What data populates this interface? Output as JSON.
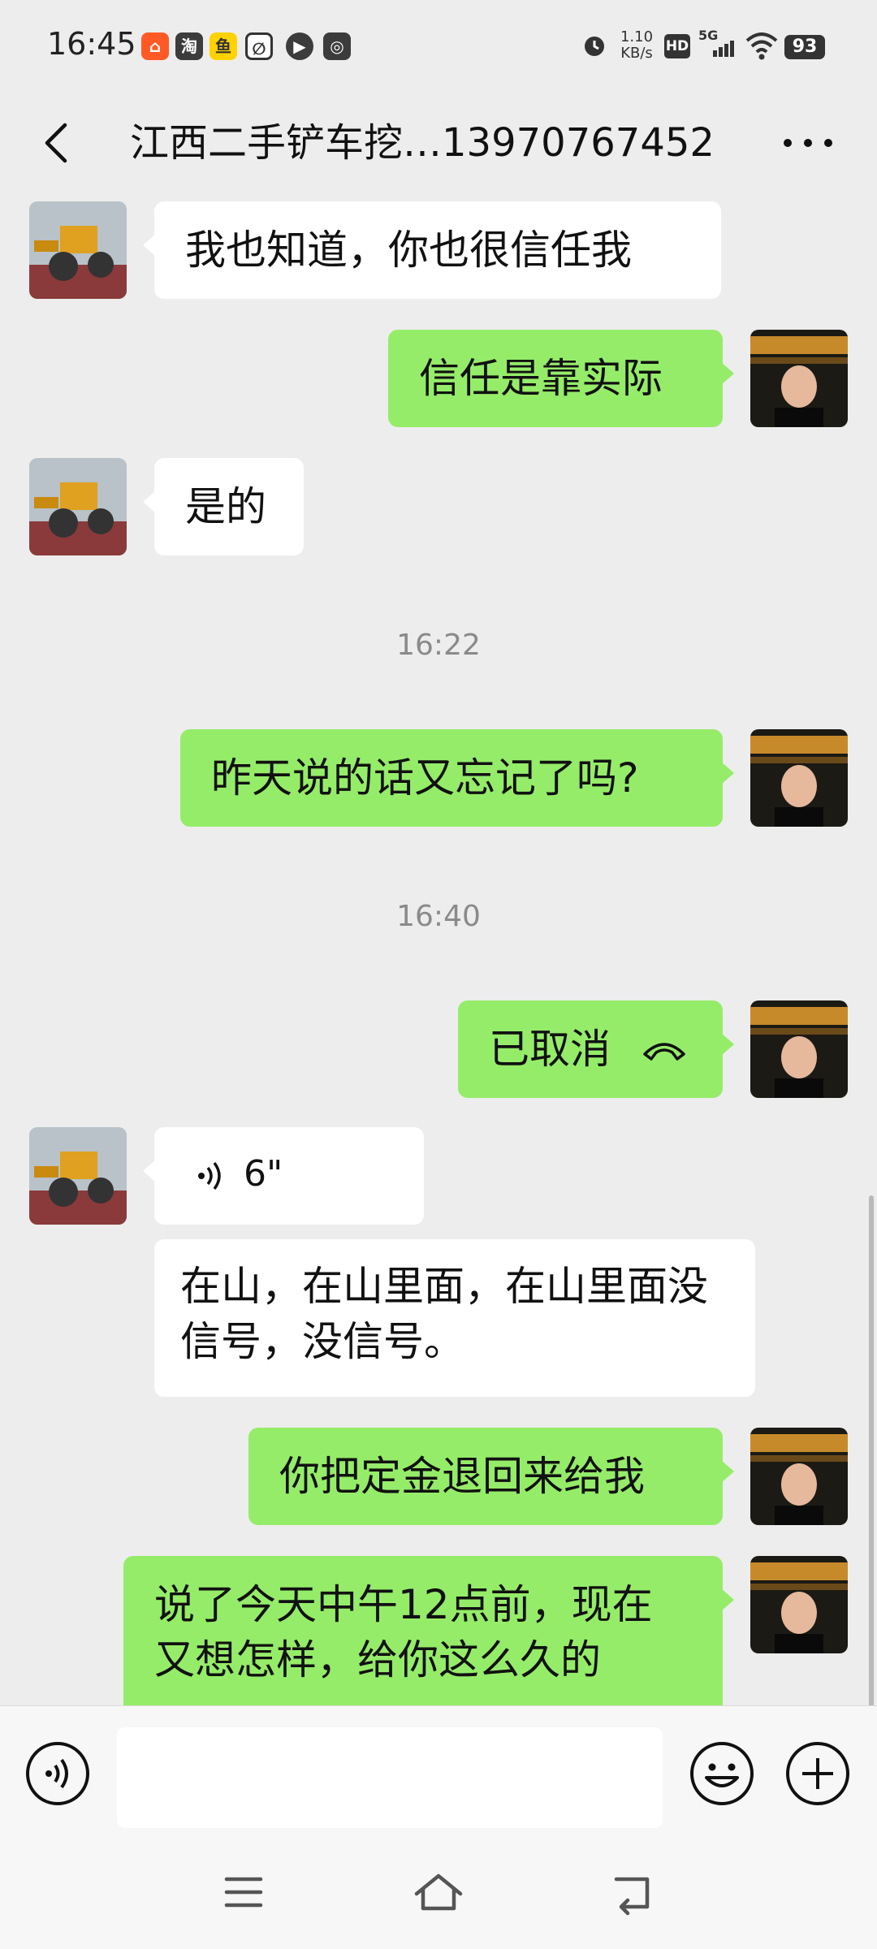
{
  "status_bar": {
    "time": "16:45",
    "net_speed_value": "1.10",
    "net_speed_unit": "KB/s",
    "hd": "HD",
    "signal": "5G",
    "battery": "93",
    "app_icons": [
      "xiaohongshu-icon",
      "taobao-icon",
      "xianyu-icon",
      "app-icon",
      "video-icon",
      "search-app-icon"
    ]
  },
  "header": {
    "title": "江西二手铲车挖…13970767452"
  },
  "messages": [
    {
      "side": "in",
      "text": "我也知道，你也很信任我"
    },
    {
      "side": "out",
      "text": "信任是靠实际"
    },
    {
      "side": "in",
      "text": "是的"
    },
    {
      "type": "time",
      "text": "16:22"
    },
    {
      "side": "out",
      "text": "昨天说的话又忘记了吗?"
    },
    {
      "type": "time",
      "text": "16:40"
    },
    {
      "side": "out",
      "text": "已取消",
      "icon": "call-ended-icon"
    },
    {
      "side": "in",
      "type": "voice",
      "text": "6\""
    },
    {
      "side": "in",
      "text": "在山，在山里面，在山里面没信号，没信号。"
    },
    {
      "side": "out",
      "text": "你把定金退回来给我"
    },
    {
      "side": "out",
      "text": "说了今天中午12点前，现在又想怎样，给你这么久的"
    }
  ],
  "input": {
    "placeholder": "",
    "value": ""
  },
  "colors": {
    "chat_bg": "#ededed",
    "outgoing_bubble": "#95ec69",
    "incoming_bubble": "#ffffff"
  }
}
